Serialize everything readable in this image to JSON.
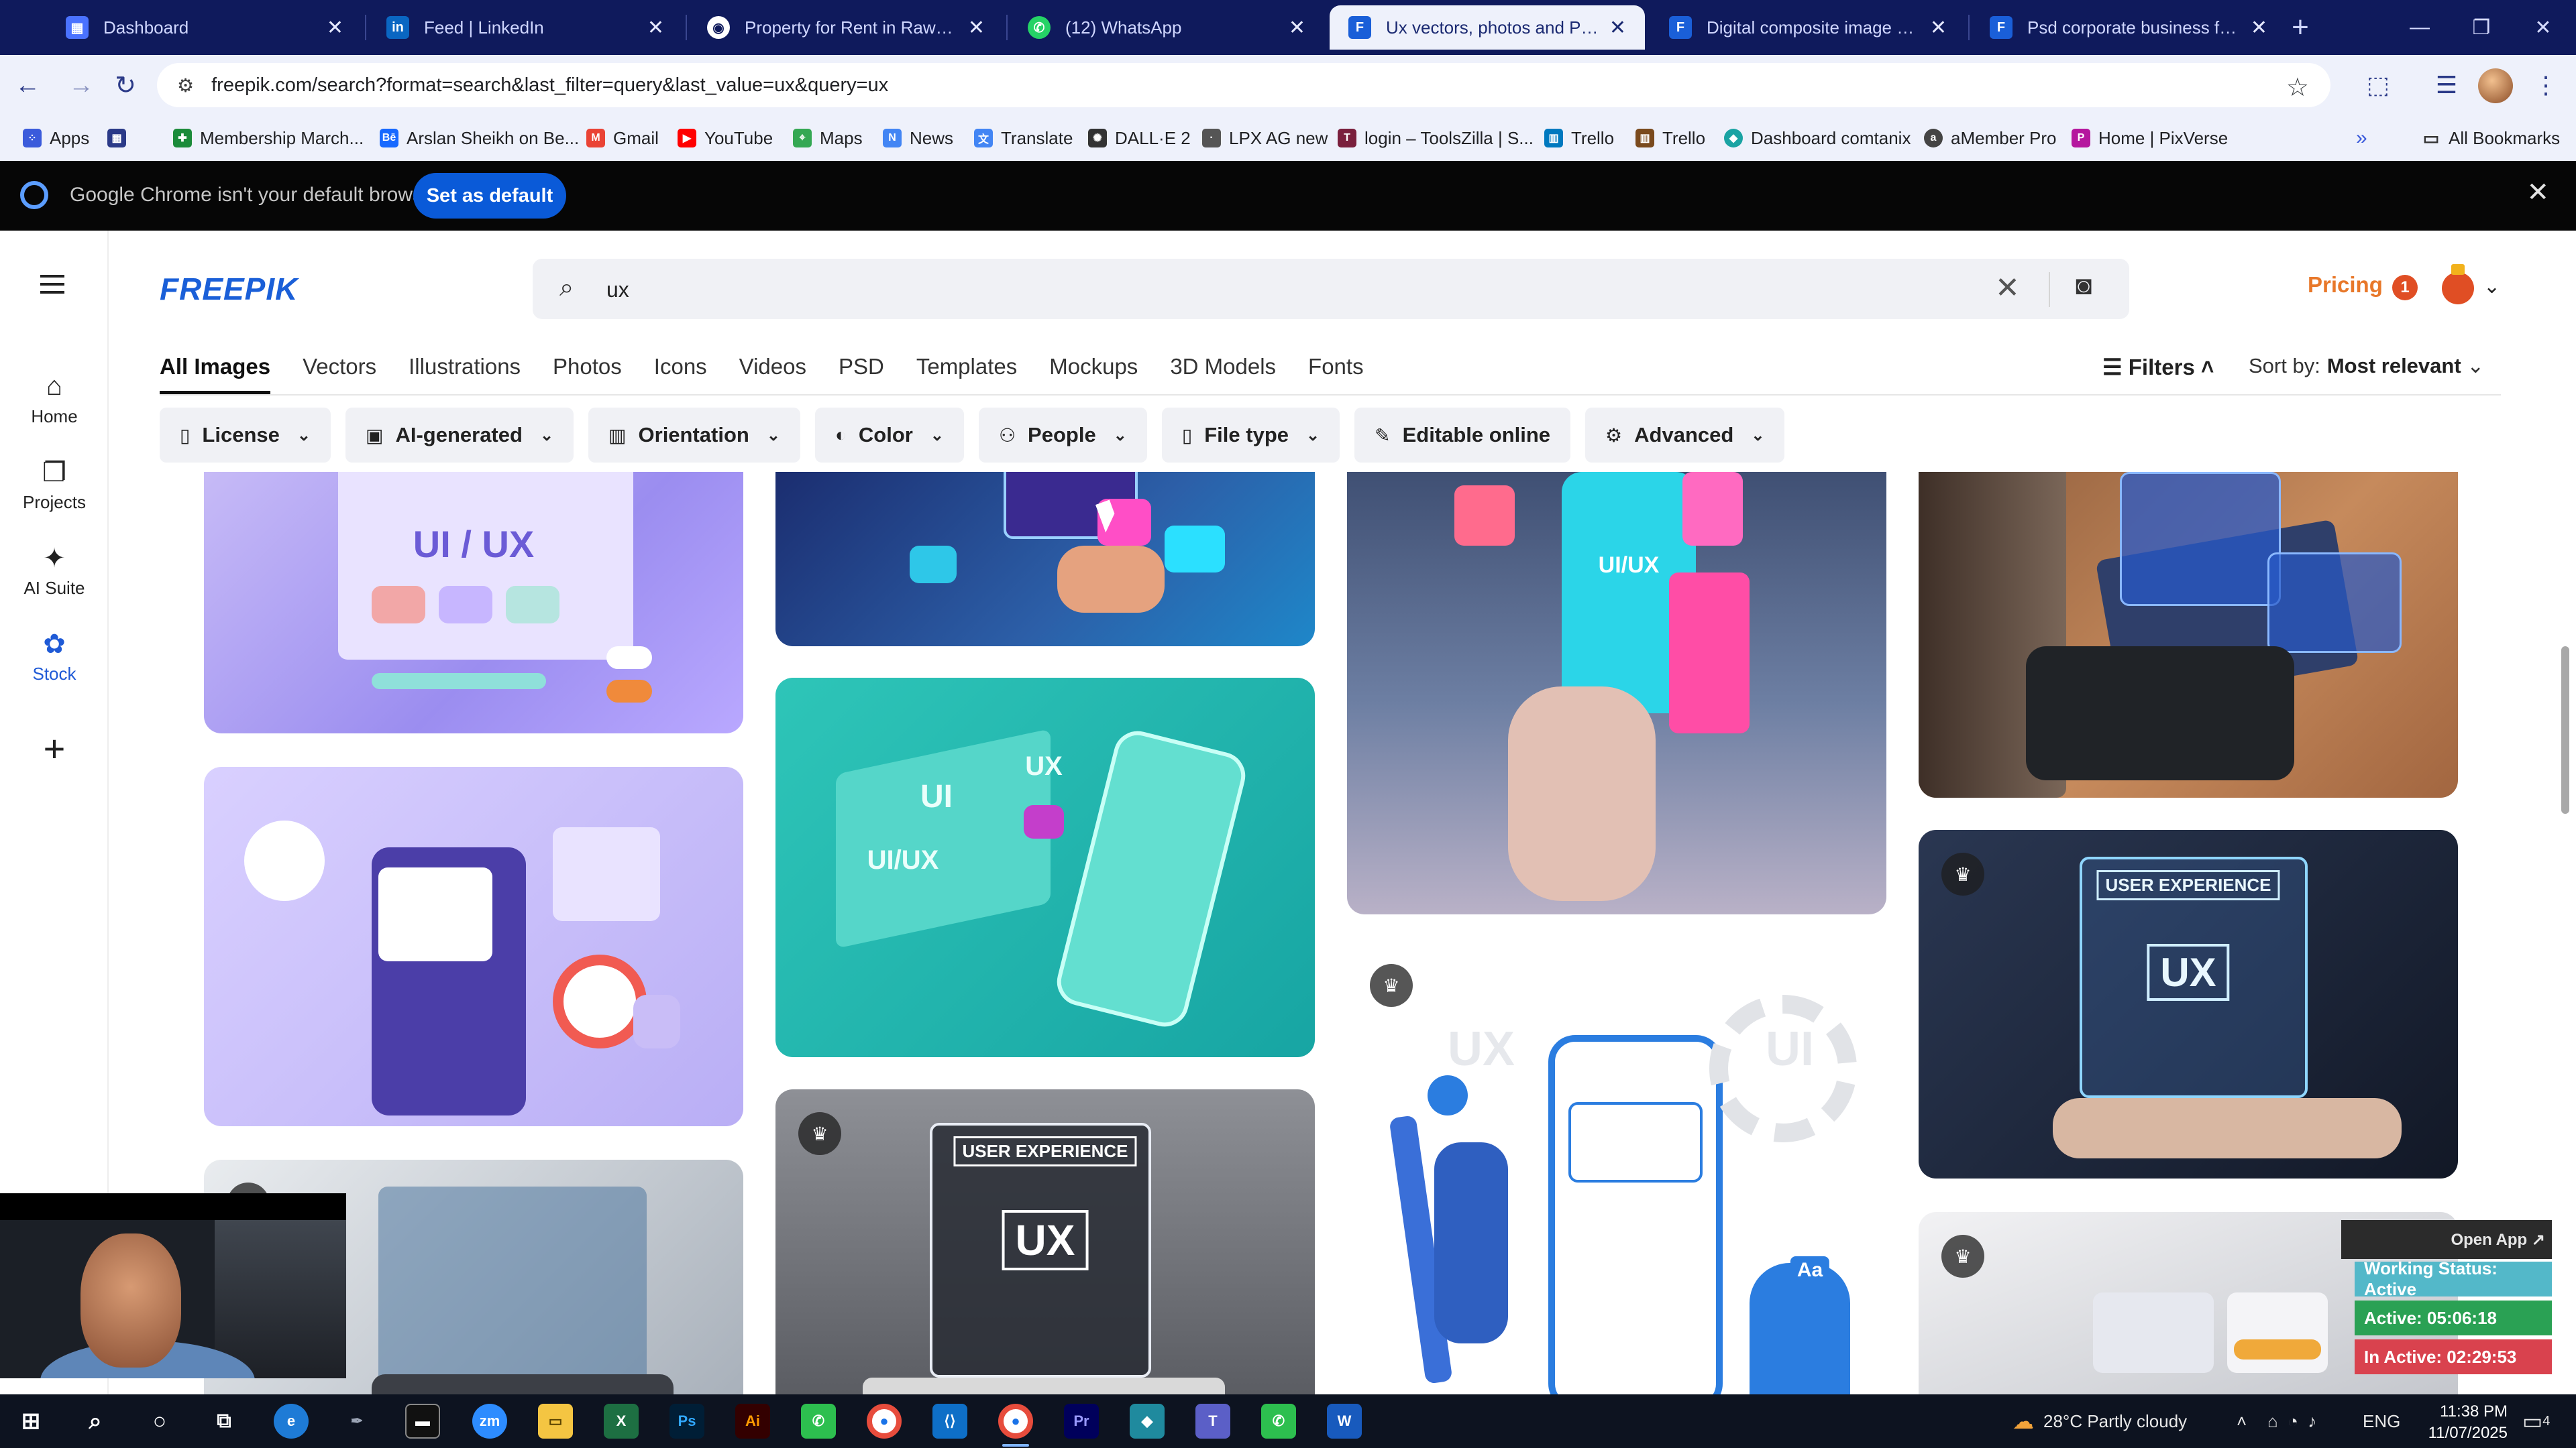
{
  "browser": {
    "tabs": [
      {
        "label": "Dashboard",
        "icon": "dashboard-favicon",
        "active": false
      },
      {
        "label": "Feed | LinkedIn",
        "icon": "linkedin-icon",
        "active": false
      },
      {
        "label": "Property for Rent in Rawalpindi",
        "icon": "property-favicon",
        "active": false
      },
      {
        "label": "(12) WhatsApp",
        "icon": "whatsapp-icon",
        "active": false
      },
      {
        "label": "Ux vectors, photos and PSD files",
        "icon": "freepik-favicon",
        "active": true
      },
      {
        "label": "Digital composite image of graphics",
        "icon": "freepik-favicon",
        "active": false
      },
      {
        "label": "Psd corporate business flyer design",
        "icon": "freepik-favicon",
        "active": false
      }
    ],
    "url": "freepik.com/search?format=search&last_filter=query&last_value=ux&query=ux",
    "bookmarks": [
      {
        "label": "Apps"
      },
      {
        "label": "Membership March..."
      },
      {
        "label": "Arslan Sheikh on Be..."
      },
      {
        "label": "Gmail"
      },
      {
        "label": "YouTube"
      },
      {
        "label": "Maps"
      },
      {
        "label": "News"
      },
      {
        "label": "Translate"
      },
      {
        "label": "DALL·E 2"
      },
      {
        "label": "LPX AG new"
      },
      {
        "label": "login – ToolsZilla | S..."
      },
      {
        "label": "Trello"
      },
      {
        "label": "Trello"
      },
      {
        "label": "Dashboard comtanix"
      },
      {
        "label": "aMember Pro"
      },
      {
        "label": "Home | PixVerse"
      }
    ],
    "all_bookmarks": "All Bookmarks",
    "infobar": {
      "text": "Google Chrome isn't your default browser",
      "button": "Set as default"
    }
  },
  "site": {
    "logo": "FREEPIK",
    "search_value": "ux",
    "pricing": "Pricing",
    "notifications": "1",
    "sidebar": [
      {
        "label": "Home",
        "icon": "home-icon"
      },
      {
        "label": "Projects",
        "icon": "projects-icon"
      },
      {
        "label": "AI Suite",
        "icon": "ai-suite-icon"
      },
      {
        "label": "Stock",
        "icon": "stock-icon"
      }
    ],
    "categories": [
      "All Images",
      "Vectors",
      "Illustrations",
      "Photos",
      "Icons",
      "Videos",
      "PSD",
      "Templates",
      "Mockups",
      "3D Models",
      "Fonts"
    ],
    "filters_label": "Filters",
    "sort_label": "Sort by:",
    "sort_value": "Most relevant",
    "chips": [
      "License",
      "AI-generated",
      "Orientation",
      "Color",
      "People",
      "File type",
      "Editable online",
      "Advanced"
    ]
  },
  "thumbnails": {
    "t1": "UI / UX",
    "t3": "UI/UX",
    "t5a": "UI",
    "t5b": "UX",
    "t5c": "UI/UX",
    "t6": "USER EXPERIENCE",
    "t6b": "UX",
    "t8": "USER EXPERIENCE",
    "t8b": "UX",
    "t9": "UX",
    "t9b": "UI",
    "t9c": "Aa"
  },
  "overlay": {
    "open_app": "Open App ↗",
    "working_status": "Working Status: Active",
    "active": "Active: 05:06:18",
    "inactive": "In Active: 02:29:53"
  },
  "taskbar": {
    "weather": "28°C  Partly cloudy",
    "lang": "ENG",
    "time": "11:38 PM",
    "date": "11/07/2025",
    "chat_count": "4"
  }
}
